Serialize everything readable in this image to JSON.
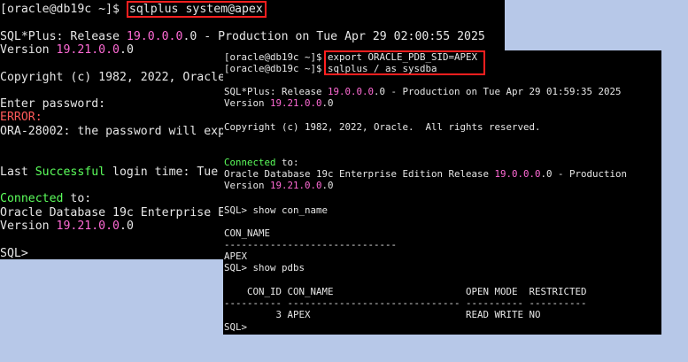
{
  "back_terminal": {
    "prompt": "[oracle@db19c ~]$ ",
    "command": "sqlplus system@apex",
    "banner_prefix": "SQL*Plus: Release ",
    "banner_release": "19.0.0.0",
    "banner_suffix": ".0 - Production on Tue Apr 29 02:00:55 2025",
    "version_label": "Version ",
    "version_number": "19.21.0.0",
    "version_suffix": ".0",
    "copyright": "Copyright (c) 1982, 2022, Oracle.",
    "enter_password": "Enter password:",
    "error_label": "ERROR:",
    "error_message": "ORA-28002: the password will expi",
    "last_prefix": "Last ",
    "last_successful": "Successful",
    "last_suffix": " login time: Tue A",
    "connected": "Connected",
    "connected_to": " to:",
    "edition": "Oracle Database 19c Enterprise Ed",
    "version2_label": "Version ",
    "version2_number": "19.21.0.0",
    "version2_suffix": ".0",
    "sql_prompt": "SQL>"
  },
  "front_terminal": {
    "prompt1": "[oracle@db19c ~]$ ",
    "command1": "export ORACLE_PDB_SID=APEX",
    "prompt2": "[oracle@db19c ~]$ ",
    "command2": "sqlplus / as sysdba",
    "banner_prefix": "SQL*Plus: Release ",
    "banner_release": "19.0.0.0",
    "banner_suffix": ".0 - Production on Tue Apr 29 01:59:35 2025",
    "version_label": "Version ",
    "version_number": "19.21.0.0",
    "version_suffix": ".0",
    "copyright": "Copyright (c) 1982, 2022, Oracle.  All rights reserved.",
    "connected": "Connected",
    "connected_to": " to:",
    "edition_prefix": "Oracle Database 19c Enterprise Edition Release ",
    "edition_release": "19.0.0.0",
    "edition_suffix": ".0 - Production",
    "version2_label": "Version ",
    "version2_number": "19.21.0.0",
    "version2_suffix": ".0",
    "cmd_show_con_name": "SQL> show con_name",
    "con_name_header": "CON_NAME",
    "con_name_rule": "------------------------------",
    "con_name_value": "APEX",
    "cmd_show_pdbs": "SQL> show pdbs",
    "pdbs_header": "    CON_ID CON_NAME                       OPEN MODE  RESTRICTED",
    "pdbs_rule": "---------- ------------------------------ ---------- ----------",
    "pdbs_row": "         3 APEX                           READ WRITE NO",
    "sql_prompt": "SQL>"
  }
}
